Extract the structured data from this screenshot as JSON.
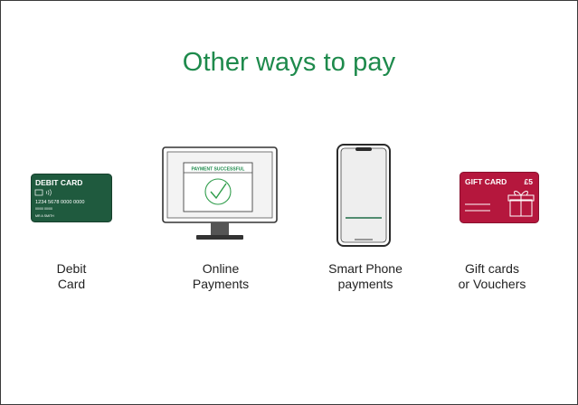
{
  "title": "Other ways to pay",
  "colors": {
    "title": "#1e8a4c",
    "debit_card": "#1f5a3e",
    "gift_card": "#b5173d",
    "success_check": "#2e9c4a"
  },
  "items": [
    {
      "icon": "debit-card-icon",
      "caption_line1": "Debit",
      "caption_line2": "Card",
      "card_heading": "DEBIT CARD",
      "card_number": "1234 5678 0000 0000",
      "card_dates": "00/00  00/00",
      "card_name": "MR A SMITH"
    },
    {
      "icon": "monitor-icon",
      "caption_line1": "Online",
      "caption_line2": "Payments",
      "screen_text": "PAYMENT SUCCESSFUL"
    },
    {
      "icon": "smartphone-icon",
      "caption_line1": "Smart Phone",
      "caption_line2": "payments"
    },
    {
      "icon": "gift-card-icon",
      "caption_line1": "Gift cards",
      "caption_line2": "or Vouchers",
      "card_heading": "GIFT CARD",
      "card_value": "£5"
    }
  ]
}
